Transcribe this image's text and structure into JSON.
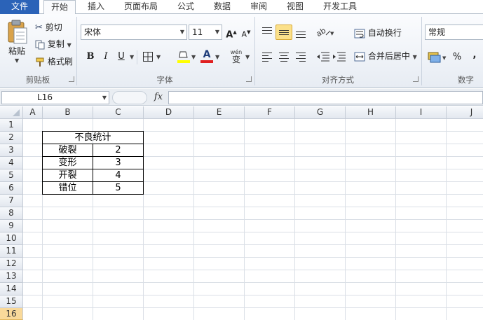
{
  "ribbon_tabs": [
    "文件",
    "开始",
    "插入",
    "页面布局",
    "公式",
    "数据",
    "审阅",
    "视图",
    "开发工具"
  ],
  "clipboard": {
    "paste_label": "粘贴",
    "cut_label": "剪切",
    "copy_label": "复制",
    "format_painter_label": "格式刷",
    "group_label": "剪贴板"
  },
  "font": {
    "font_name": "宋体",
    "font_size": "11",
    "grow_label": "A",
    "shrink_label": "A",
    "bold_label": "B",
    "italic_label": "I",
    "underline_label": "U",
    "font_color_label": "A",
    "phonetic_label": "wén",
    "phonetic_char": "变",
    "group_label": "字体"
  },
  "alignment": {
    "wrap_text_label": "自动换行",
    "merge_center_label": "合并后居中",
    "group_label": "对齐方式"
  },
  "number": {
    "format_value": "常规",
    "percent_label": "%",
    "comma_label": ",",
    "group_label": "数字"
  },
  "formula_bar": {
    "name_box": "L16",
    "fx_label": "fx",
    "formula": ""
  },
  "columns": [
    "A",
    "B",
    "C",
    "D",
    "E",
    "F",
    "G",
    "H",
    "I",
    "J"
  ],
  "rows": [
    "1",
    "2",
    "3",
    "4",
    "5",
    "6",
    "7",
    "8",
    "9",
    "10",
    "11",
    "12",
    "13",
    "14",
    "15",
    "16"
  ],
  "active_row": "16",
  "table": {
    "title": "不良统计",
    "rows": [
      {
        "label": "破裂",
        "value": "2"
      },
      {
        "label": "变形",
        "value": "3"
      },
      {
        "label": "开裂",
        "value": "4"
      },
      {
        "label": "错位",
        "value": "5"
      }
    ]
  },
  "colors": {
    "file_tab": "#2b63b8",
    "active_row_header": "#f9d99a",
    "fill_color_swatch": "#ffff00",
    "font_color_swatch": "#e02020"
  }
}
